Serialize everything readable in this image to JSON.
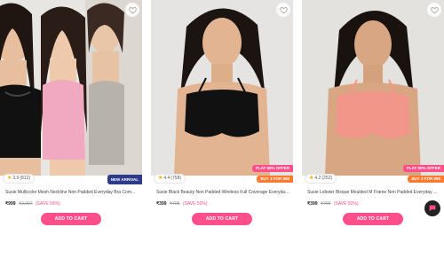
{
  "products": [
    {
      "rating": "3.9",
      "reviews": "(812)",
      "badge": "NEW ARRIVAL",
      "title": "Susie Multicolor Mesh Neckline Non Padded Everyday Bra Com...",
      "price": "₹999",
      "mrp": "₹2,097",
      "save": "(SAVE 58%)",
      "cta": "ADD TO CART"
    },
    {
      "rating": "4.4",
      "reviews": "(758)",
      "badge_flat": "FLAT 50% OFFER",
      "badge_buy": "BUY 3 FOR 999",
      "title": "Susie Black Beauty Non Padded Wireless Full Coverage Everyda...",
      "price": "₹399",
      "mrp": "₹795",
      "save": "(SAVE 50%)",
      "cta": "ADD TO CART"
    },
    {
      "rating": "4.2",
      "reviews": "(252)",
      "badge_flat": "FLAT 50% OFFER",
      "badge_buy": "BUY 3 FOR 999",
      "title": "Susie Lobster Bisque Moulded M Frame Non Padded Everyday ...",
      "price": "₹399",
      "mrp": "₹799",
      "save": "(SAVE 50%)",
      "cta": "ADD TO CART"
    }
  ],
  "colors": {
    "accent": "#ff4f8a",
    "new_badge": "#2e3a8c",
    "buy_badge": "#ff7a2f"
  },
  "icons": [
    "heart-icon",
    "star-icon",
    "chat-icon"
  ]
}
